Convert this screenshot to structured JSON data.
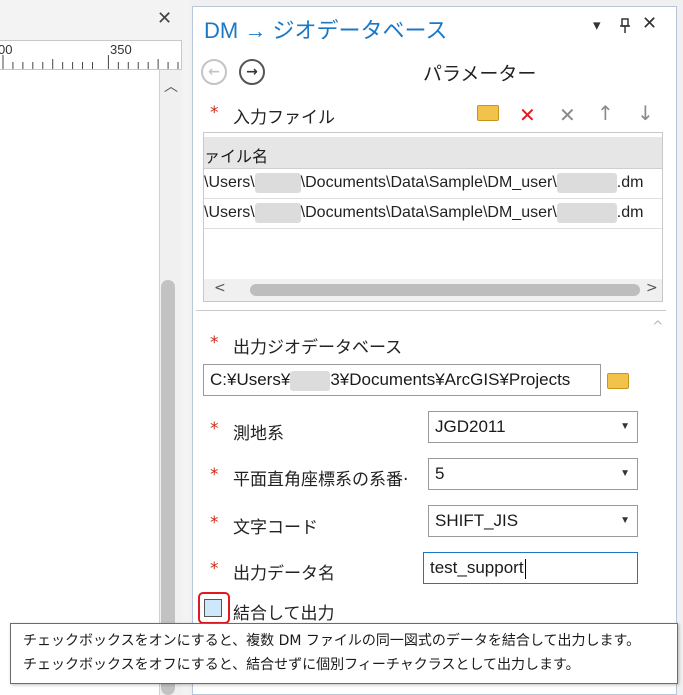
{
  "left_panel": {
    "close_tab": "✕",
    "ruler_labels": [
      "00",
      "350"
    ]
  },
  "pane": {
    "title": "DM → ジオデータベース",
    "controls": {
      "dropdown": "▾",
      "pin": "📌",
      "close": "✕"
    },
    "nav": {
      "back": "←",
      "forward": "→"
    },
    "parameters_title": "パラメーター",
    "input_files": {
      "label": "入力ファイル",
      "required_mark": "*",
      "tools": {
        "remove": "✕",
        "clear": "✕",
        "up": "↑",
        "down": "↓"
      },
      "column_header": "ァイル名",
      "rows": [
        {
          "pre": "\\Users\\",
          "post": "\\Documents\\Data\\Sample\\DM_user\\",
          "ext": ".dm"
        },
        {
          "pre": "\\Users\\",
          "post": "\\Documents\\Data\\Sample\\DM_user\\",
          "ext": ".dm"
        }
      ],
      "scroll_left": "<",
      "scroll_right": ">"
    },
    "collapse_caret": "^",
    "output_gdb": {
      "label": "出力ジオデータベース",
      "required_mark": "*",
      "value_pre": "C:¥Users¥",
      "value_post": "3¥Documents¥ArcGIS¥Projects"
    },
    "geodetic": {
      "label": "測地系",
      "required_mark": "*",
      "value": "JGD2011"
    },
    "plane_rect": {
      "label": "平面直角座標系の系番·",
      "required_mark": "*",
      "value": "5"
    },
    "charset": {
      "label": "文字コード",
      "required_mark": "*",
      "value": "SHIFT_JIS"
    },
    "output_name": {
      "label": "出力データ名",
      "required_mark": "*",
      "value": "test_support"
    },
    "merge": {
      "label": "結合して出力",
      "checked": false
    }
  },
  "tooltip": {
    "line1": "チェックボックスをオンにすると、複数 DM ファイルの同一図式のデータを結合して出力します。",
    "line2": "チェックボックスをオフにすると、結合せずに個別フィーチャクラスとして出力します。"
  },
  "colors": {
    "title_blue": "#1c78c4",
    "required_red": "#c42b1c",
    "highlight_red": "#e0181f",
    "checkbox_fill": "#cde8fb"
  }
}
